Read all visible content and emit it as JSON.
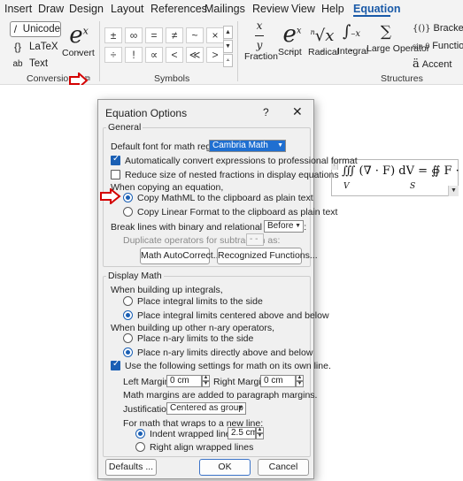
{
  "tabs": [
    "Insert",
    "Draw",
    "Design",
    "Layout",
    "References",
    "Mailings",
    "Review",
    "View",
    "Help",
    "Equation"
  ],
  "ribbon": {
    "conversions": {
      "items": [
        {
          "icon": "slash-icon",
          "glyph": "/",
          "label": "Unicode"
        },
        {
          "icon": "braces-icon",
          "glyph": "{}",
          "label": "LaTeX"
        },
        {
          "icon": "text-ab-icon",
          "glyph": "ab",
          "label": "Text"
        }
      ],
      "convert_label": "Convert",
      "convert_glyph": "e",
      "convert_sup": "x",
      "group_label": "Conversions"
    },
    "symbols": {
      "row1": [
        "±",
        "∞",
        "=",
        "≠",
        "~",
        "×"
      ],
      "row2": [
        "÷",
        "!",
        "∝",
        "<",
        "≪",
        ">"
      ],
      "group_label": "Symbols"
    },
    "structures": {
      "fraction_label": "Fraction",
      "script_label": "Script",
      "radical_label": "Radical",
      "integral_label": "Integral",
      "large_operator_label": "Large Operator",
      "bracket_label": "Bracket",
      "function_label": "Function",
      "accent_label": "Accent",
      "bracket_glyph": "{()}",
      "function_glyph": "sin θ",
      "accent_glyph": "ä",
      "group_label": "Structures"
    }
  },
  "equation": {
    "lhs": "∭ (∇ · F) dV = ∯ F · dS",
    "lower_v": "V",
    "lower_s": "S"
  },
  "dialog": {
    "title": "Equation Options",
    "help": "?",
    "close": "✕",
    "general": {
      "legend": "General",
      "font_label": "Default font for math regions:",
      "font_value": "Cambria Math",
      "auto_convert": {
        "label": "Automatically convert expressions to professional format",
        "checked": true
      },
      "reduce_size": {
        "label": "Reduce size of nested fractions in display equations",
        "checked": false
      },
      "copying_label": "When copying an equation,",
      "copy_mathml": {
        "label": "Copy MathML to the clipboard as plain text",
        "checked": true
      },
      "copy_linear": {
        "label": "Copy Linear Format to the clipboard as plain text",
        "checked": false
      },
      "break_lines_label": "Break lines with binary and relational operators:",
      "break_lines_value": "Before",
      "duplicate_label": "Duplicate operators for subtraction as:",
      "duplicate_value": "- -",
      "autocorrect_button": "Math AutoCorrect...",
      "functions_button": "Recognized Functions..."
    },
    "display": {
      "legend": "Display Math",
      "integrals_label": "When building up integrals,",
      "integral_side": {
        "label": "Place integral limits to the side",
        "checked": false
      },
      "integral_center": {
        "label": "Place integral limits centered above and below",
        "checked": true
      },
      "nary_label": "When building up other n-ary operators,",
      "nary_side": {
        "label": "Place n-ary limits to the side",
        "checked": false
      },
      "nary_center": {
        "label": "Place n-ary limits directly above and below",
        "checked": true
      },
      "use_settings": {
        "label": "Use the following settings for math on its own line.",
        "checked": true
      },
      "left_margin_label": "Left Margin:",
      "left_margin_value": "0 cm",
      "right_margin_label": "Right Margin:",
      "right_margin_value": "0 cm",
      "margins_note": "Math margins are added to paragraph margins.",
      "justification_label": "Justification:",
      "justification_value": "Centered as group",
      "wrap_label": "For math that wraps to a new line:",
      "indent_wrapped": {
        "label": "Indent wrapped lines by:",
        "checked": true
      },
      "indent_value": "2.5 cm",
      "right_align": {
        "label": "Right align wrapped lines",
        "checked": false
      }
    },
    "defaults_button": "Defaults ...",
    "ok_button": "OK",
    "cancel_button": "Cancel"
  },
  "colors": {
    "accent": "#1a5aa8",
    "annotation": "#d40000",
    "highlight": "#1f6fd1"
  }
}
